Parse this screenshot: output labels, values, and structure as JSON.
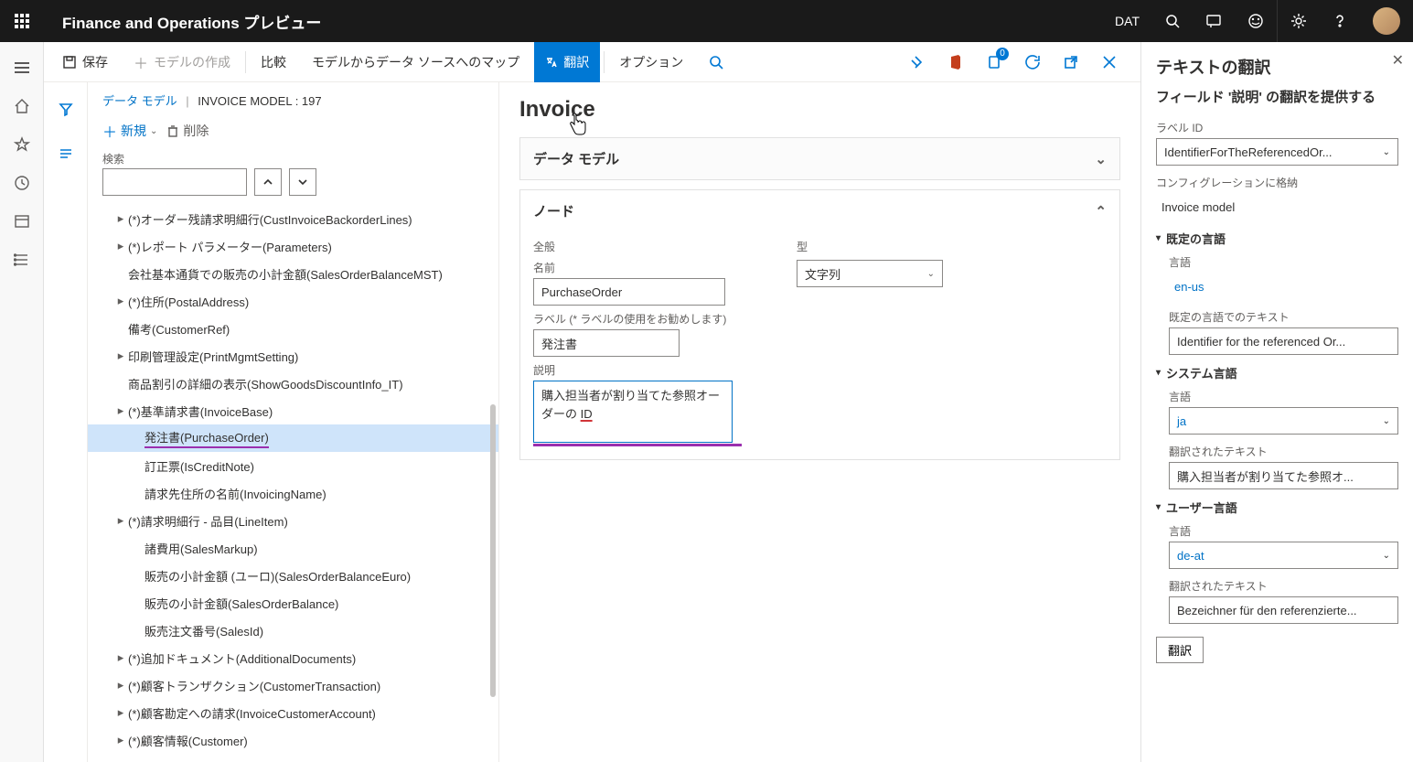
{
  "header": {
    "brand": "Finance and Operations プレビュー",
    "company": "DAT"
  },
  "cmdbar": {
    "save": "保存",
    "createModel": "モデルの作成",
    "compare": "比較",
    "mapToDs": "モデルからデータ ソースへのマップ",
    "translate": "翻訳",
    "options": "オプション",
    "badge": "0"
  },
  "breadcrumb": {
    "link": "データ モデル",
    "current": "INVOICE MODEL : 197"
  },
  "treeTools": {
    "new": "新規",
    "delete": "削除",
    "search": "検索"
  },
  "tree": [
    {
      "lvl": 0,
      "caret": true,
      "label": "(*)オーダー残請求明細行(CustInvoiceBackorderLines)"
    },
    {
      "lvl": 0,
      "caret": true,
      "label": "(*)レポート パラメーター(Parameters)"
    },
    {
      "lvl": 0,
      "caret": false,
      "label": "会社基本通貨での販売の小計金額(SalesOrderBalanceMST)"
    },
    {
      "lvl": 0,
      "caret": true,
      "label": "(*)住所(PostalAddress)"
    },
    {
      "lvl": 0,
      "caret": false,
      "label": "備考(CustomerRef)"
    },
    {
      "lvl": 0,
      "caret": true,
      "label": "印刷管理設定(PrintMgmtSetting)"
    },
    {
      "lvl": 0,
      "caret": false,
      "label": "商品割引の詳細の表示(ShowGoodsDiscountInfo_IT)"
    },
    {
      "lvl": 0,
      "caret": true,
      "label": "(*)基準請求書(InvoiceBase)"
    },
    {
      "lvl": 1,
      "caret": false,
      "label": "発注書(PurchaseOrder)",
      "sel": true,
      "ul": true
    },
    {
      "lvl": 1,
      "caret": false,
      "label": "訂正票(IsCreditNote)"
    },
    {
      "lvl": 1,
      "caret": false,
      "label": "請求先住所の名前(InvoicingName)"
    },
    {
      "lvl": 0,
      "caret": true,
      "label": "(*)請求明細行 - 品目(LineItem)"
    },
    {
      "lvl": 1,
      "caret": false,
      "label": "諸費用(SalesMarkup)"
    },
    {
      "lvl": 1,
      "caret": false,
      "label": "販売の小計金額 (ユーロ)(SalesOrderBalanceEuro)"
    },
    {
      "lvl": 1,
      "caret": false,
      "label": "販売の小計金額(SalesOrderBalance)"
    },
    {
      "lvl": 1,
      "caret": false,
      "label": "販売注文番号(SalesId)"
    },
    {
      "lvl": 0,
      "caret": true,
      "label": "(*)追加ドキュメント(AdditionalDocuments)"
    },
    {
      "lvl": 0,
      "caret": true,
      "label": "(*)顧客トランザクション(CustomerTransaction)"
    },
    {
      "lvl": 0,
      "caret": true,
      "label": "(*)顧客勘定への請求(InvoiceCustomerAccount)"
    },
    {
      "lvl": 0,
      "caret": true,
      "label": "(*)顧客情報(Customer)"
    }
  ],
  "form": {
    "title": "Invoice",
    "card1": "データ モデル",
    "card2": "ノード",
    "section_general": "全般",
    "name_lbl": "名前",
    "name_val": "PurchaseOrder",
    "label_lbl": "ラベル (* ラベルの使用をお勧めします)",
    "label_val": "発注書",
    "desc_lbl": "説明",
    "desc_val_a": "購入担当者が割り当てた参照オーダーの ",
    "desc_val_b": "ID",
    "type_lbl": "型",
    "type_val": "文字列"
  },
  "rp": {
    "title": "テキストの翻訳",
    "subtitle": "フィールド '説明' の翻訳を提供する",
    "labelId_lbl": "ラベル ID",
    "labelId_val": "IdentifierForTheReferencedOr...",
    "storedIn_lbl": "コンフィグレーションに格納",
    "storedIn_val": "Invoice model",
    "sec_default": "既定の言語",
    "lang_lbl": "言語",
    "lang_default": "en-us",
    "default_text_lbl": "既定の言語でのテキスト",
    "default_text_val": "Identifier for the referenced Or...",
    "sec_system": "システム言語",
    "lang_system": "ja",
    "translated_lbl": "翻訳されたテキスト",
    "translated_system": "購入担当者が割り当てた参照オ...",
    "sec_user": "ユーザー言語",
    "lang_user": "de-at",
    "translated_user": "Bezeichner für den referenzierte...",
    "translate_btn": "翻訳"
  }
}
